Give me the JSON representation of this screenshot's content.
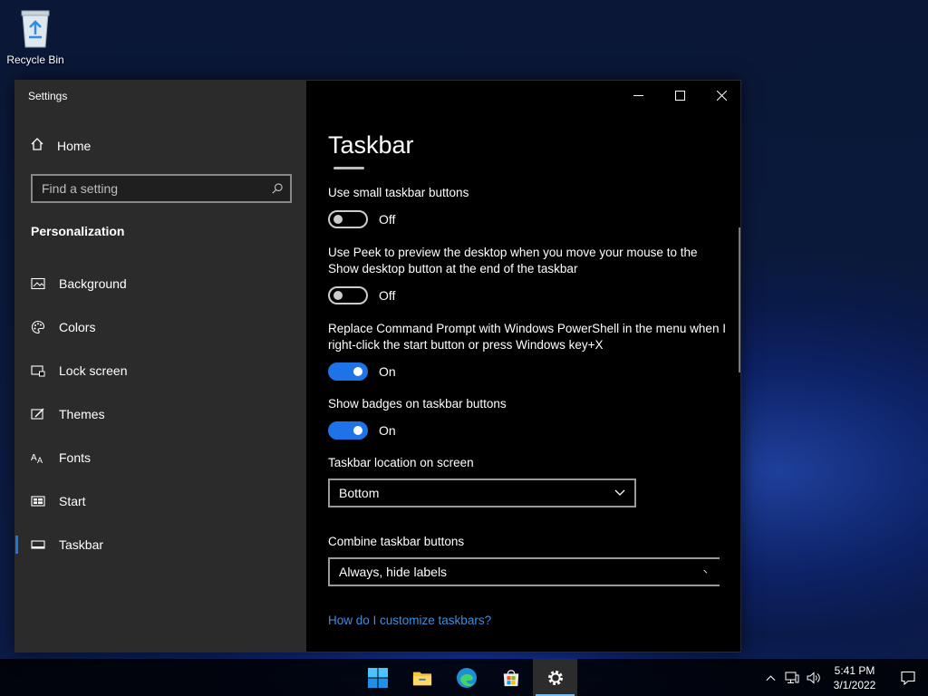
{
  "desktop": {
    "recycle_bin_label": "Recycle Bin"
  },
  "window": {
    "title": "Settings",
    "home_label": "Home",
    "search_placeholder": "Find a setting",
    "section_title": "Personalization",
    "nav_items": [
      {
        "label": "Background",
        "icon": "picture-icon"
      },
      {
        "label": "Colors",
        "icon": "palette-icon"
      },
      {
        "label": "Lock screen",
        "icon": "lock-screen-icon"
      },
      {
        "label": "Themes",
        "icon": "themes-icon"
      },
      {
        "label": "Fonts",
        "icon": "fonts-icon"
      },
      {
        "label": "Start",
        "icon": "start-icon"
      },
      {
        "label": "Taskbar",
        "icon": "taskbar-icon",
        "active": true
      }
    ]
  },
  "content": {
    "page_title": "Taskbar",
    "settings": [
      {
        "label": "Use small taskbar buttons",
        "state": "Off"
      },
      {
        "label": "Use Peek to preview the desktop when you move your mouse to the Show desktop button at the end of the taskbar",
        "state": "Off"
      },
      {
        "label": "Replace Command Prompt with Windows PowerShell in the menu when I right-click the start button or press Windows key+X",
        "state": "On"
      },
      {
        "label": "Show badges on taskbar buttons",
        "state": "On"
      }
    ],
    "location_label": "Taskbar location on screen",
    "location_value": "Bottom",
    "combine_label": "Combine taskbar buttons",
    "combine_value": "Always, hide labels",
    "help_link": "How do I customize taskbars?"
  },
  "taskbar": {
    "apps": [
      "start-icon",
      "file-explorer-icon",
      "edge-icon",
      "store-icon",
      "settings-icon"
    ],
    "time": "5:41 PM",
    "date": "3/1/2022"
  },
  "colors": {
    "accent": "#1e73e8",
    "link": "#3b8ee0",
    "sidebar": "#2b2b2b"
  }
}
